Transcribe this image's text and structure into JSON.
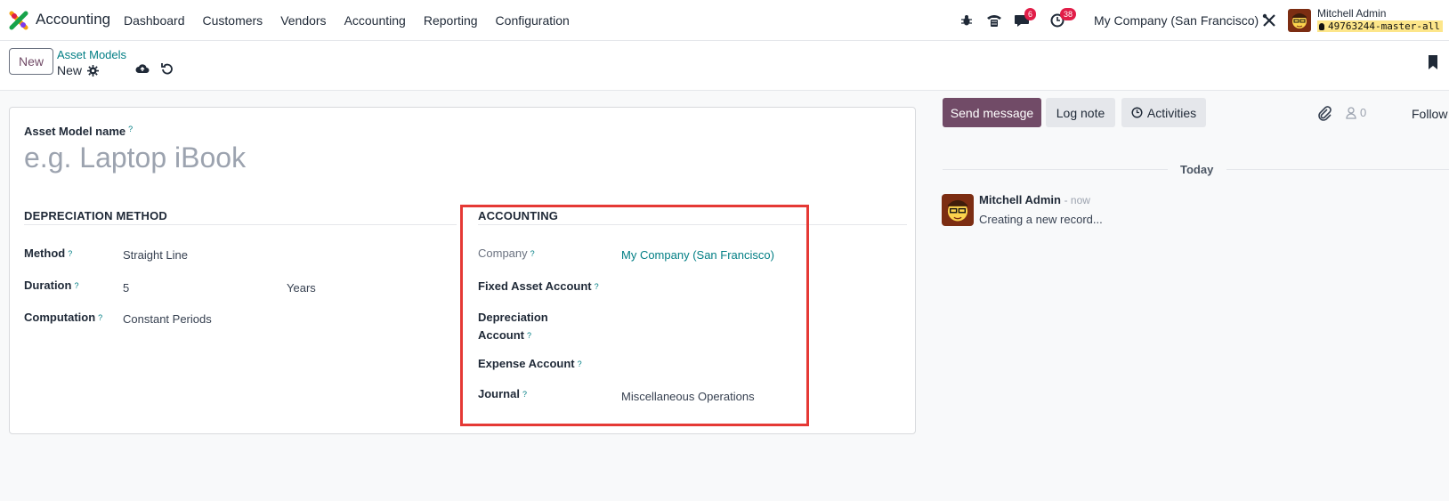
{
  "app": {
    "name": "Accounting",
    "menu": [
      "Dashboard",
      "Customers",
      "Vendors",
      "Accounting",
      "Reporting",
      "Configuration"
    ]
  },
  "systray": {
    "messages_count": "6",
    "activities_count": "38",
    "company": "My Company (San Francisco)",
    "user_name": "Mitchell Admin",
    "database": "49763244-master-all"
  },
  "control_panel": {
    "new_label": "New",
    "breadcrumb": "Asset Models",
    "record_name": "New"
  },
  "form": {
    "name_label": "Asset Model name",
    "name_placeholder": "e.g. Laptop iBook",
    "help_mark": "?",
    "depreciation": {
      "title": "DEPRECIATION METHOD",
      "method_label": "Method",
      "method_value": "Straight Line",
      "duration_label": "Duration",
      "duration_value": "5",
      "duration_unit": "Years",
      "computation_label": "Computation",
      "computation_value": "Constant Periods"
    },
    "accounting": {
      "title": "ACCOUNTING",
      "company_label": "Company",
      "company_value": "My Company (San Francisco)",
      "fixed_asset_label": "Fixed Asset Account",
      "depreciation_label_1": "Depreciation",
      "depreciation_label_2": "Account",
      "expense_label": "Expense Account",
      "journal_label": "Journal",
      "journal_value": "Miscellaneous Operations"
    }
  },
  "chatter": {
    "send_message": "Send message",
    "log_note": "Log note",
    "activities": "Activities",
    "followers_count": "0",
    "follow": "Follow",
    "date_separator": "Today",
    "message": {
      "author": "Mitchell Admin",
      "time": "- now",
      "body": "Creating a new record..."
    }
  },
  "colors": {
    "brand": "#714b67",
    "link": "#017e84",
    "highlight": "#e53935"
  }
}
